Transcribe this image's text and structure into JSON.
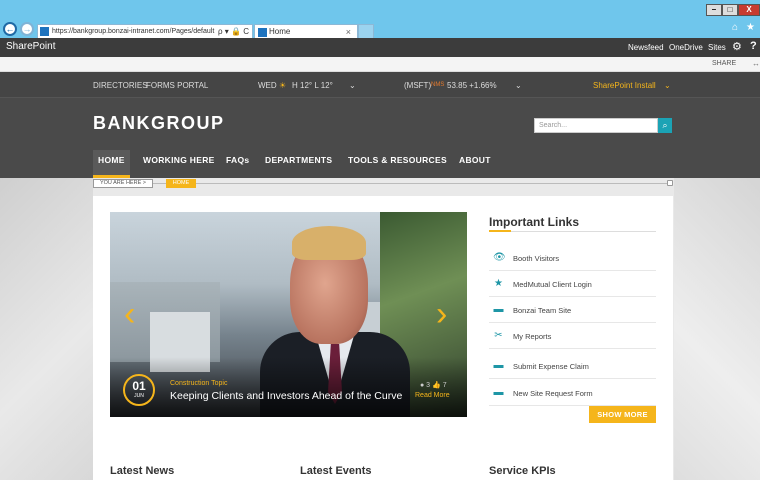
{
  "browser": {
    "url": "https://bankgroup.bonzai-intranet.com/Pages/default",
    "url_controls": "ρ ▾ 🔒 C",
    "tab_title": "Home",
    "tab_close": "×",
    "back": "←",
    "forward": "→",
    "minimize": "–",
    "maximize": "□",
    "close": "X",
    "home_icon": "⌂",
    "star_icon": "★"
  },
  "suite": {
    "brand": "SharePoint",
    "links": [
      "Newsfeed",
      "OneDrive",
      "Sites"
    ],
    "gear": "⚙",
    "help": "?"
  },
  "share_bar": {
    "share": "SHARE",
    "sync": "↔"
  },
  "header_top": {
    "directories": "DIRECTORIES",
    "forms_portal": "FORMS PORTAL",
    "weather_day": "WED",
    "weather_icon": "☀",
    "weather_temp": "H 12° L 12°",
    "weather_chevron": "⌄",
    "stock_symbol": "(MSFT)",
    "stock_exchange": "NMS",
    "stock_value": "53.85 +1.66%",
    "stock_chevron": "⌄",
    "install": "SharePoint Install",
    "install_chevron": "⌄"
  },
  "logo": "BANKGROUP",
  "search": {
    "placeholder": "Search...",
    "icon": "⌕"
  },
  "nav": [
    "HOME",
    "WORKING HERE",
    "FAQs",
    "DEPARTMENTS",
    "TOOLS & RESOURCES",
    "ABOUT"
  ],
  "breadcrumb": {
    "you_are_here": "YOU ARE HERE >",
    "current": "HOME"
  },
  "hero": {
    "date_day": "01",
    "date_month": "JUN",
    "topic": "Construction Topic",
    "headline": "Keeping Clients and Investors Ahead of the Curve",
    "comments": "● 3",
    "likes": "👍 7",
    "read_more": "Read More",
    "prev": "‹",
    "next": "›"
  },
  "important_links": {
    "title": "Important Links",
    "items": [
      {
        "label": "Booth Visitors",
        "icon": "👁"
      },
      {
        "label": "MedMutual Client Login",
        "icon": "★"
      },
      {
        "label": "Bonzai Team Site",
        "icon": "▬"
      },
      {
        "label": "My Reports",
        "icon": "✂"
      },
      {
        "label": "Submit Expense Claim",
        "icon": "▬"
      },
      {
        "label": "New Site Request Form",
        "icon": "▬"
      }
    ],
    "show_more": "SHOW MORE"
  },
  "sections": [
    "Latest News",
    "Latest Events",
    "Service KPIs"
  ],
  "colors": {
    "accent": "#f5b51b",
    "teal": "#1e96a6",
    "header": "#4a4a4a"
  }
}
